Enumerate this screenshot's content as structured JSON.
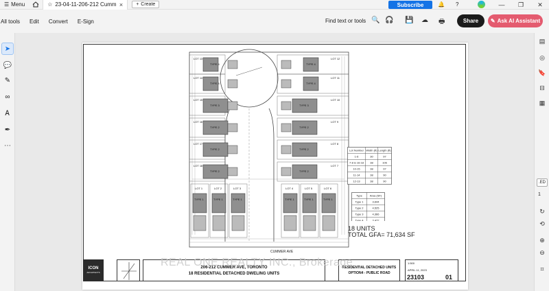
{
  "titlebar": {
    "menu_label": "Menu",
    "tab_title": "23-04-11-206-212 Cumm...",
    "create_label": "Create",
    "subscribe_label": "Subscribe"
  },
  "toolbar": {
    "menu_items": [
      "All tools",
      "Edit",
      "Convert",
      "E-Sign"
    ],
    "find_label": "Find text or tools",
    "share_label": "Share",
    "ai_label": "Ask AI Assistant"
  },
  "right_rail": {
    "page_badge": ".ED",
    "page_number": "1"
  },
  "drawing": {
    "lots_left": [
      "LOT 13",
      "LOT 14",
      "LOT 15",
      "LOT 16",
      "LOT 17",
      "LOT 18"
    ],
    "lots_right": [
      "LOT 12",
      "LOT 11",
      "LOT 10",
      "LOT 9",
      "LOT 8",
      "LOT 7"
    ],
    "types_left": [
      "TYPE 4",
      "TYPE 4",
      "TYPE 3",
      "TYPE 2",
      "TYPE 2",
      "TYPE 2"
    ],
    "types_right": [
      "TYPE 4",
      "TYPE 4",
      "TYPE 3",
      "TYPE 2",
      "TYPE 2",
      "TYPE 2"
    ],
    "bottom_lots_left": [
      "LOT 1",
      "LOT 2",
      "LOT 3"
    ],
    "bottom_lots_right": [
      "LOT 4",
      "LOT 5",
      "LOT 6"
    ],
    "bottom_type": "TYPE 1",
    "street_label": "CUMMER AVE",
    "lot_table": {
      "headers": [
        "Lot Number",
        "Width (ft)",
        "Length (ft)"
      ],
      "rows": [
        [
          "1-6",
          "30",
          "97"
        ],
        [
          "7-8 & 16-18",
          "38",
          "106"
        ],
        [
          "10-15",
          "38",
          "97"
        ],
        [
          "11-14",
          "38",
          "90"
        ],
        [
          "12-13",
          "38",
          "90"
        ]
      ]
    },
    "area_table": {
      "headers": [
        "Type",
        "Area (SF)"
      ],
      "rows": [
        [
          "Type 1",
          "3,644"
        ],
        [
          "Type 2",
          "4,525"
        ],
        [
          "Type 3",
          "4,366"
        ],
        [
          "Type 4",
          "3,472"
        ]
      ]
    },
    "units_text": "18 UNITS",
    "gfa_text": "TOTAL GFA= 71,634 SF"
  },
  "title_block": {
    "logo_name": "ICON",
    "logo_sub": "ARCHITECTS",
    "address": "206-212 CUMMER AVE, TORONTO",
    "description": "18 RESIDENTIAL DETACHED DWELING UNITS",
    "option_line1": "RESIDENTIAL DETACHED UNITS",
    "option_line2": "OPTION4 - PUBLIC ROAD",
    "scale": "1:500",
    "date": "APRIL 11, 2023",
    "project_number": "23103",
    "sheet_number": "01"
  },
  "watermark": "REAL ONE REALTY INC., Brokerage",
  "colors": {
    "accent": "#1473e6",
    "ai_button": "#e45b6f",
    "share_button": "#1b1b1b"
  }
}
